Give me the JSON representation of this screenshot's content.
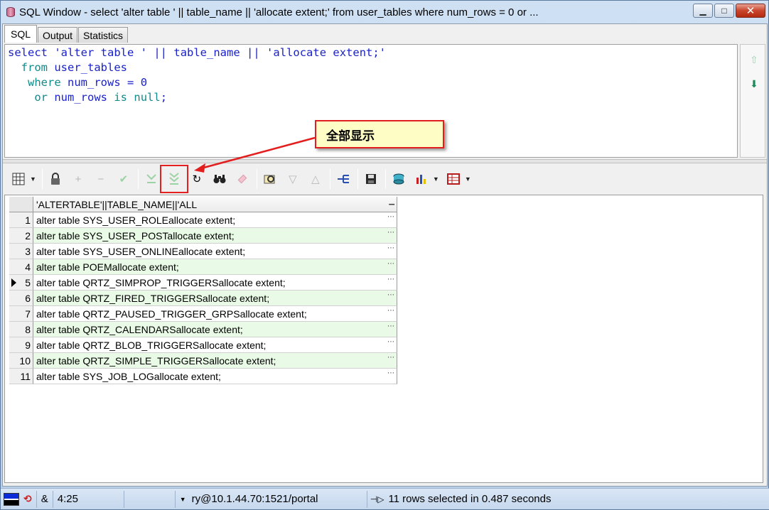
{
  "window": {
    "title": "SQL Window - select 'alter table ' || table_name || 'allocate extent;' from user_tables where num_rows = 0 or ...",
    "minimize": "▁",
    "maximize": "□",
    "close": "✕"
  },
  "tabs": [
    {
      "label": "SQL",
      "active": true
    },
    {
      "label": "Output",
      "active": false
    },
    {
      "label": "Statistics",
      "active": false
    }
  ],
  "sql": {
    "line1": {
      "kw": "select",
      "str1": "'alter table '",
      "op1": "||",
      "id": "table_name",
      "op2": "||",
      "str2": "'allocate extent;'"
    },
    "line2": {
      "kw": "from",
      "id": "user_tables"
    },
    "line3": {
      "kw": "where",
      "id": "num_rows",
      "op": "=",
      "num": "0"
    },
    "line4": {
      "kw": "or",
      "id": "num_rows",
      "is": "is",
      "null": "null",
      "semi": ";"
    }
  },
  "callout": {
    "text": "全部显示"
  },
  "toolbar": {
    "icons": [
      "grid-icon",
      "lock-icon",
      "add-record-icon",
      "delete-record-icon",
      "post-icon",
      "fetch-next-icon",
      "fetch-all-icon",
      "refresh-icon",
      "find-icon",
      "clear-icon",
      "query-by-example-icon",
      "next-page-icon",
      "previous-page-icon",
      "connect-icon",
      "save-icon",
      "export-icon",
      "chart-icon",
      "table-export-icon"
    ]
  },
  "grid": {
    "column_header": "'ALTERTABLE'||TABLE_NAME||'ALL",
    "current_row": 5,
    "rows": [
      {
        "n": "1",
        "value": "alter table SYS_USER_ROLEallocate extent;"
      },
      {
        "n": "2",
        "value": "alter table SYS_USER_POSTallocate extent;"
      },
      {
        "n": "3",
        "value": "alter table SYS_USER_ONLINEallocate extent;"
      },
      {
        "n": "4",
        "value": "alter table POEMallocate extent;"
      },
      {
        "n": "5",
        "value": "alter table QRTZ_SIMPROP_TRIGGERSallocate extent;"
      },
      {
        "n": "6",
        "value": "alter table QRTZ_FIRED_TRIGGERSallocate extent;"
      },
      {
        "n": "7",
        "value": "alter table QRTZ_PAUSED_TRIGGER_GRPSallocate extent;"
      },
      {
        "n": "8",
        "value": "alter table QRTZ_CALENDARSallocate extent;"
      },
      {
        "n": "9",
        "value": "alter table QRTZ_BLOB_TRIGGERSallocate extent;"
      },
      {
        "n": "10",
        "value": "alter table QRTZ_SIMPLE_TRIGGERSallocate extent;"
      },
      {
        "n": "11",
        "value": "alter table SYS_JOB_LOGallocate extent;"
      }
    ]
  },
  "status": {
    "amp": "&",
    "position": "4:25",
    "connection": "ry@10.1.44.70:1521/portal",
    "message": "11 rows selected in 0.487 seconds"
  }
}
